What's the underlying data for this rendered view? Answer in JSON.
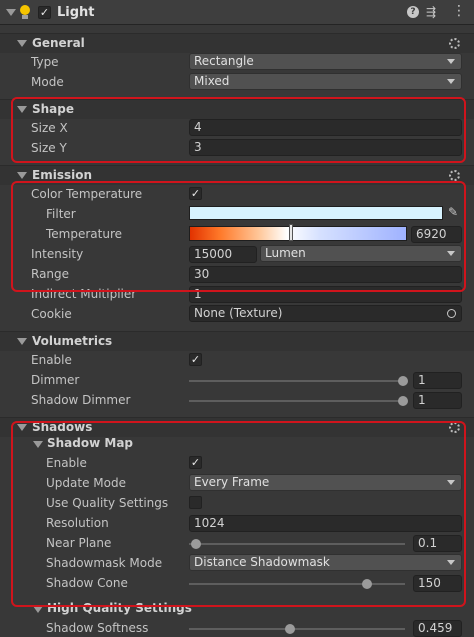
{
  "component": {
    "title": "Light",
    "enabled": true
  },
  "general": {
    "title": "General",
    "type_label": "Type",
    "type_value": "Rectangle",
    "mode_label": "Mode",
    "mode_value": "Mixed"
  },
  "shape": {
    "title": "Shape",
    "size_x_label": "Size X",
    "size_x_value": "4",
    "size_y_label": "Size Y",
    "size_y_value": "3"
  },
  "emission": {
    "title": "Emission",
    "color_temp_label": "Color Temperature",
    "color_temp_enabled": true,
    "filter_label": "Filter",
    "filter_color": "#d7f3ff",
    "temperature_label": "Temperature",
    "temperature_value": "6920",
    "intensity_label": "Intensity",
    "intensity_value": "15000",
    "intensity_unit": "Lumen",
    "range_label": "Range",
    "range_value": "30",
    "indirect_label": "Indirect Multiplier",
    "indirect_value": "1",
    "cookie_label": "Cookie",
    "cookie_value": "None (Texture)"
  },
  "volumetrics": {
    "title": "Volumetrics",
    "enable_label": "Enable",
    "enable_value": true,
    "dimmer_label": "Dimmer",
    "dimmer_value": "1",
    "shadow_dimmer_label": "Shadow Dimmer",
    "shadow_dimmer_value": "1"
  },
  "shadows": {
    "title": "Shadows",
    "shadow_map_title": "Shadow Map",
    "enable_label": "Enable",
    "enable_value": true,
    "update_mode_label": "Update Mode",
    "update_mode_value": "Every Frame",
    "use_quality_label": "Use Quality Settings",
    "use_quality_value": false,
    "resolution_label": "Resolution",
    "resolution_value": "1024",
    "near_plane_label": "Near Plane",
    "near_plane_value": "0.1",
    "shadowmask_label": "Shadowmask Mode",
    "shadowmask_value": "Distance Shadowmask",
    "shadow_cone_label": "Shadow Cone",
    "shadow_cone_value": "150",
    "hq_title": "High Quality Settings",
    "softness_label": "Shadow Softness",
    "softness_value": "0.459"
  },
  "colors": {
    "highlight": "#d0141c",
    "bulb": "#f5c400"
  }
}
